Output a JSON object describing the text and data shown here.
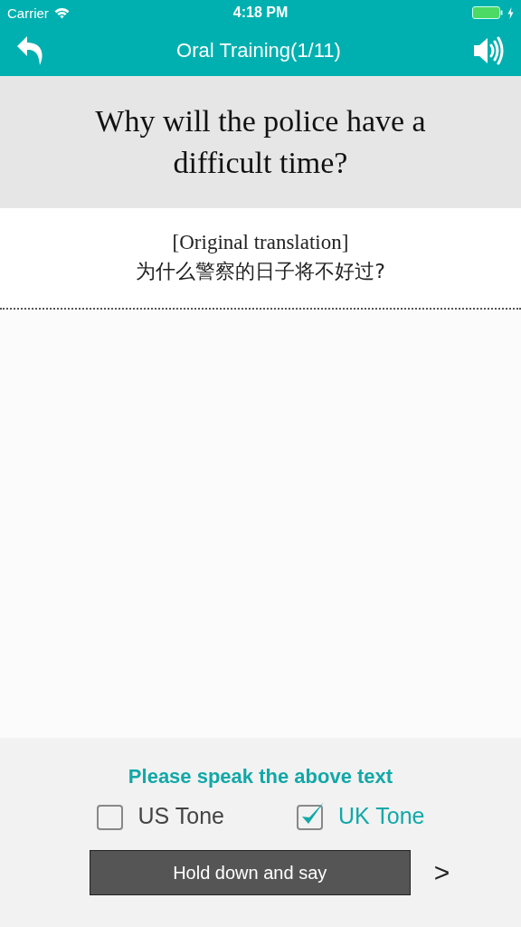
{
  "status_bar": {
    "carrier": "Carrier",
    "time": "4:18 PM"
  },
  "nav": {
    "title": "Oral Training(1/11)"
  },
  "question": "Why will the police have a difficult time?",
  "translation": {
    "label": "[Original translation]",
    "text": "为什么警察的日子将不好过?"
  },
  "prompt": "Please speak the above text",
  "tones": [
    {
      "label": "US Tone",
      "selected": false
    },
    {
      "label": "UK Tone",
      "selected": true
    }
  ],
  "record_button": "Hold down and say",
  "next": ">"
}
